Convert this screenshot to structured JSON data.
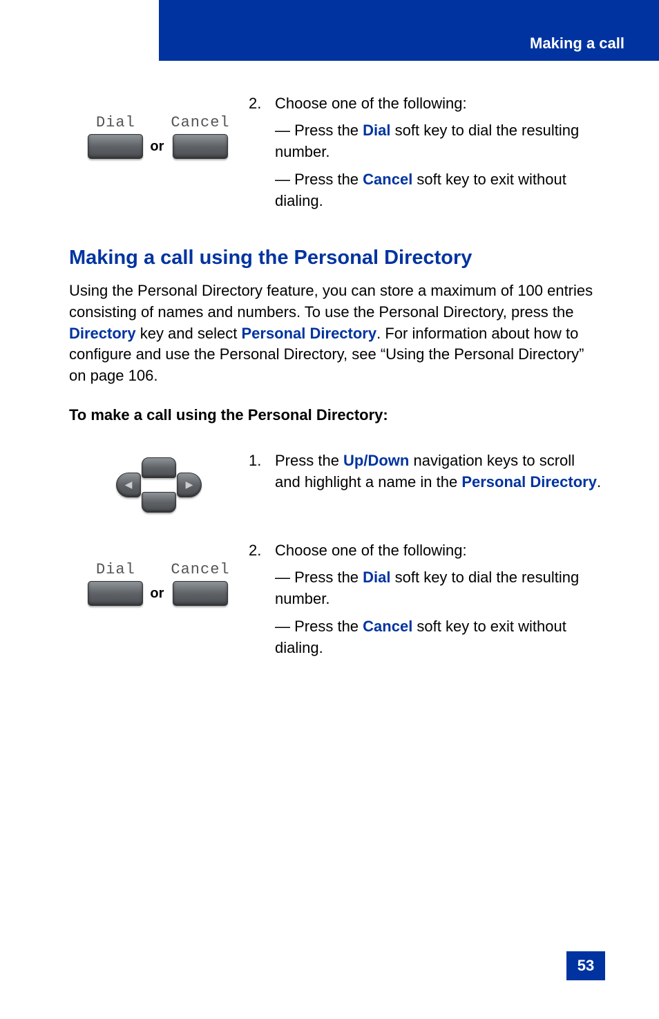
{
  "header": {
    "title": "Making a call"
  },
  "step2_top": {
    "dial_label": "Dial",
    "cancel_label": "Cancel",
    "or": "or",
    "num": "2.",
    "intro": "Choose one of the following:",
    "a_prefix": "— Press the ",
    "a_key": "Dial",
    "a_suffix": " soft key to dial the resulting number.",
    "b_prefix": "— Press the ",
    "b_key": "Cancel",
    "b_suffix": " soft key to exit without dialing."
  },
  "section": {
    "heading": "Making a call using the Personal Directory",
    "p1a": "Using the Personal Directory feature, you can store a maximum of 100 entries consisting of names and numbers. To use the Personal Directory, press the ",
    "p1_key1": "Directory",
    "p1b": " key and select ",
    "p1_key2": "Personal Directory",
    "p1c": ". For information about how to configure and use the Personal Directory, see “Using the Personal Directory” on page 106.",
    "subheading": "To make a call using the Personal Directory:"
  },
  "step1": {
    "num": "1.",
    "a": "Press the ",
    "key1": "Up/Down",
    "b": " navigation keys to scroll and highlight a name in the ",
    "key2": "Personal Directory",
    "c": "."
  },
  "step2_bottom": {
    "dial_label": "Dial",
    "cancel_label": "Cancel",
    "or": "or",
    "num": "2.",
    "intro": "Choose one of the following:",
    "a_prefix": "— Press the ",
    "a_key": "Dial",
    "a_suffix": " soft key to dial the resulting number.",
    "b_prefix": "— Press the ",
    "b_key": "Cancel",
    "b_suffix": " soft key to exit without dialing."
  },
  "page_number": "53"
}
